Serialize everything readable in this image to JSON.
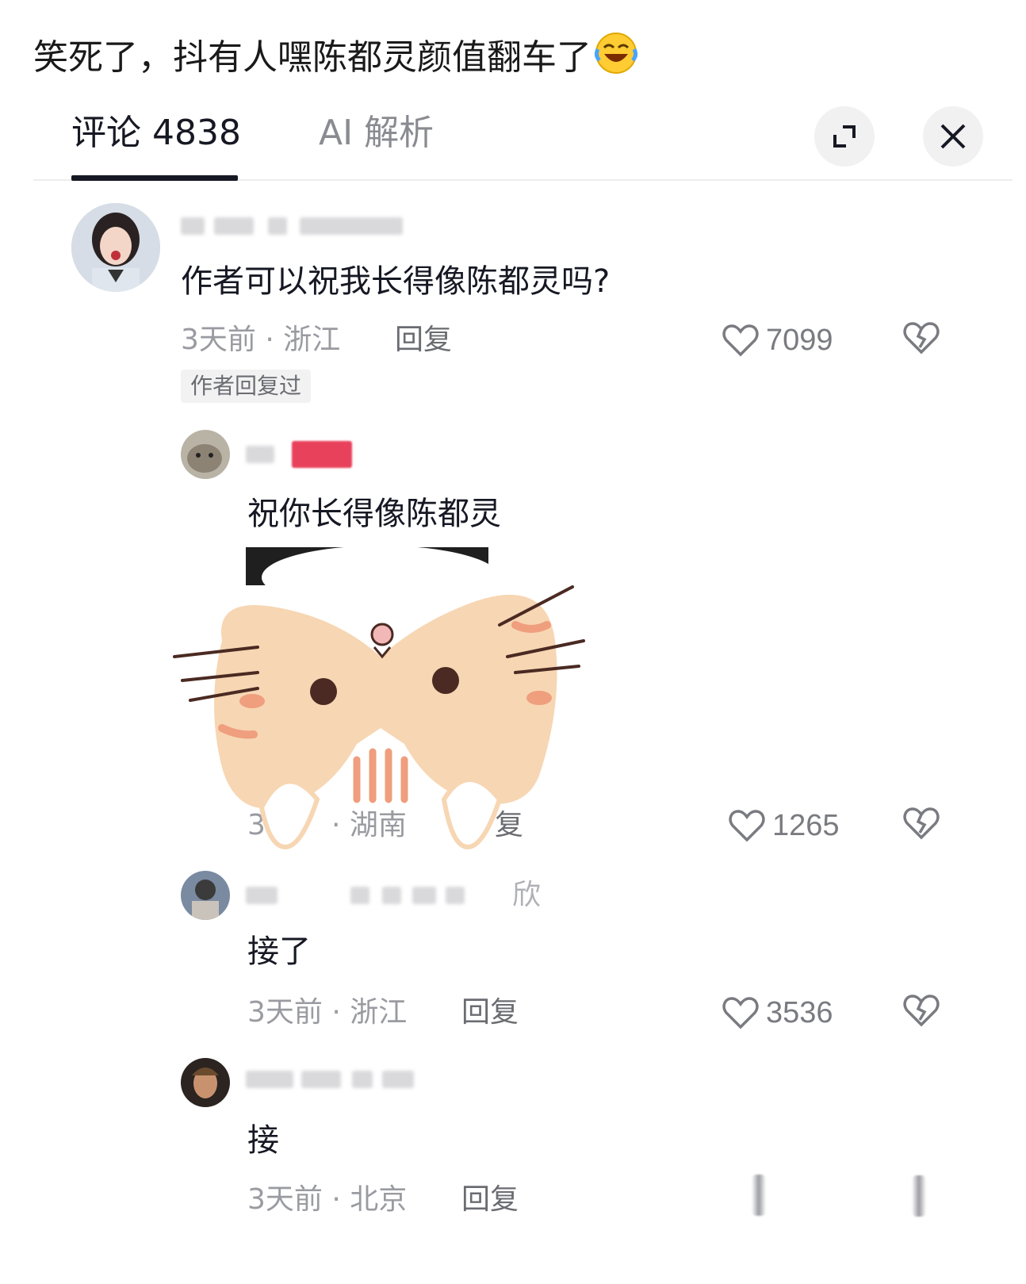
{
  "post": {
    "title": "笑死了，抖有人嘿陈都灵颜值翻车了"
  },
  "tabs": {
    "comments": "评论 4838",
    "ai": "AI 解析"
  },
  "comments": [
    {
      "text": "作者可以祝我长得像陈都灵吗?",
      "meta": "3天前 · 浙江",
      "reply": "回复",
      "likes": "7099",
      "badge": "作者回复过"
    },
    {
      "text": "祝你长得像陈都灵",
      "meta_partial_left": "3",
      "meta_partial_mid": "· 湖南",
      "reply_partial": "复",
      "likes": "1265"
    },
    {
      "name_fragment": "欣",
      "text": "接了",
      "meta": "3天前 · 浙江",
      "reply": "回复",
      "likes": "3536"
    },
    {
      "text": "接",
      "meta": "3天前 · 北京",
      "reply": "回复"
    }
  ],
  "icons": {
    "expand": "expand-icon",
    "close": "close-icon",
    "like": "heart-outline-icon",
    "dislike": "broken-heart-icon",
    "emoji": "rofl-emoji-icon"
  },
  "colors": {
    "text": "#161823",
    "muted": "#9a9ba1",
    "accent_pink": "#e8415b",
    "sticker_fill": "#f7d6b3"
  }
}
